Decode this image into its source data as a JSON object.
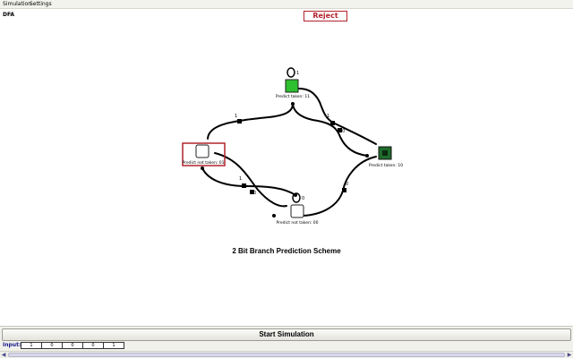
{
  "menu": {
    "items": [
      {
        "label": "Simulation"
      },
      {
        "label": "Settings"
      }
    ]
  },
  "document": {
    "title": "DFA"
  },
  "status": {
    "result": "Reject"
  },
  "diagram": {
    "title": "2 Bit Branch Prediction Scheme",
    "states": [
      {
        "id": "11",
        "label": "Predict taken: 11",
        "fill": "#2ec02e",
        "self_loop_label": "1"
      },
      {
        "id": "01",
        "label": "Predict not taken: 01",
        "fill": "#ffffff",
        "selected": true
      },
      {
        "id": "10",
        "label": "Predict taken: 10",
        "fill": "#1f6b2a"
      },
      {
        "id": "00",
        "label": "Predict not taken: 00",
        "fill": "#ffffff",
        "self_loop_label": "0"
      }
    ],
    "transition_labels": {
      "01_to_11": "1",
      "11_to_10": "1",
      "11_to_01": "0",
      "10_to_11": "0",
      "01_to_00": "1",
      "00_to_01": "0",
      "00_to_10": "0"
    },
    "colors": {
      "selected_border": "#b2222c",
      "edge": "#000000"
    }
  },
  "controls": {
    "start_label": "Start Simulation"
  },
  "input": {
    "label": "Input:",
    "values": [
      "1",
      "0",
      "0",
      "0",
      "1"
    ]
  }
}
